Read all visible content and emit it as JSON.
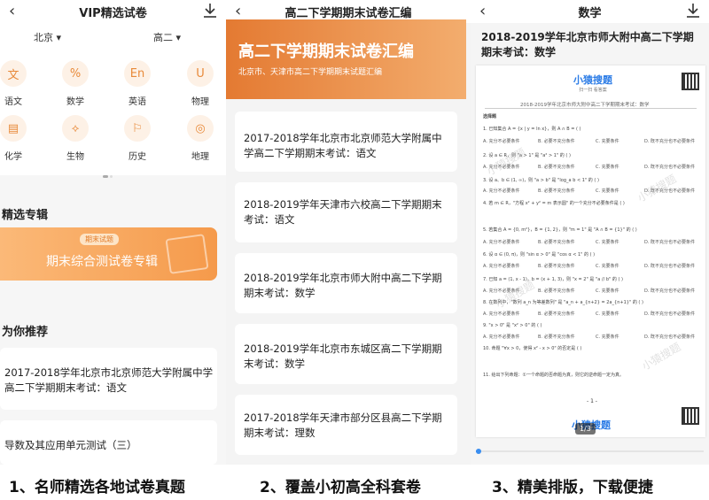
{
  "panel1": {
    "header_title": "VIP精选试卷",
    "filter_region": "北京 ▾",
    "filter_grade": "高二 ▾",
    "subjects": [
      {
        "label": "语文",
        "glyph": "文",
        "icon": "book-icon"
      },
      {
        "label": "数学",
        "glyph": "%",
        "icon": "percent-icon"
      },
      {
        "label": "英语",
        "glyph": "En",
        "icon": "english-icon"
      },
      {
        "label": "物理",
        "glyph": "U",
        "icon": "magnet-icon"
      },
      {
        "label": "化学",
        "glyph": "▤",
        "icon": "flask-icon"
      },
      {
        "label": "生物",
        "glyph": "⟡",
        "icon": "dna-icon"
      },
      {
        "label": "历史",
        "glyph": "⚐",
        "icon": "flag-icon"
      },
      {
        "label": "地理",
        "glyph": "◎",
        "icon": "globe-icon"
      }
    ],
    "featured_title": "精选专辑",
    "banner_tag": "期末试题",
    "banner_text": "期末综合测试卷专辑",
    "recommend_title": "为你推荐",
    "recommend_items": [
      "2017-2018学年北京市北京师范大学附属中学高二下学期期末考试：语文",
      "导数及其应用单元测试（三）"
    ]
  },
  "panel2": {
    "header_title": "高二下学期期末试卷汇编",
    "banner_title": "高二下学期期末试卷汇编",
    "banner_sub": "北京市、天津市高二下学期期末试题汇编",
    "items": [
      "2017-2018学年北京市北京师范大学附属中学高二下学期期末考试：语文",
      "2018-2019学年天津市六校高二下学期期末考试：语文",
      "2018-2019学年北京市师大附中高二下学期期末考试：数学",
      "2018-2019学年北京市东城区高二下学期期末考试：数学",
      "2017-2018学年天津市部分区县高二下学期期末考试：理数"
    ]
  },
  "panel3": {
    "header_title": "数学",
    "doc_title": "2018-2019学年北京市师大附中高二下学期期末考试：数学",
    "logo": "小猿搜题",
    "logo_sub": "扫一扫 看答案",
    "page_line": "2018-2019学年北京市师大附中高二下学期期末考试：数学",
    "section": "选择题",
    "questions": [
      "1. 已知集合 A = {x | y = ln x}，则 A ∩ B = (   )",
      "2. 设 a ∈ R，则 \"a > 1\" 是 \"a² > 1\" 的 (   )",
      "3. 设 a、b ∈ (1, ∞)，则 \"a > b\" 是 \"log_a b < 1\" 的 (   )",
      "4. 若 m ∈ R，\"方程 x² + y² = m 表示圆\" 的一个充分不必要条件是 (   )",
      "5. 若集合 A = {0, m²}，B = {1, 2}，则 \"m = 1\" 是 \"A ∩ B = {1}\" 的 (   )",
      "6. 设 α ∈ (0, π)，则 \"sin α > 0\" 是 \"cos α < 1\" 的 (   )",
      "7. 已知 a = (1, x - 1)，b = (x + 1, 3)，则 \"x = 2\" 是 \"a // b\" 的 (   )",
      "8. 在数列中，\"数列 a_n 为等差数列\" 是 \"a_n + a_{n+2} = 2a_{n+1}\" 的 (   )",
      "9. \"x > 0\" 是 \"x² > 0\" 的 (   )",
      "10. 命题 \"∀x > 0，使得 x² - x > 0\" 的否定是 (   )",
      "11. 给出下列命题：①一个命题的否命题为真，则它的逆命题一定为真。"
    ],
    "options": [
      "A. 充分不必要条件",
      "B. 必要不充分条件",
      "C. 充要条件",
      "D. 既不充分也不必要条件"
    ],
    "watermark": "小猿搜题",
    "page_number": "- 1 -",
    "page_counter": "1/3",
    "scroll_progress": 0.01
  },
  "captions": [
    "1、名师精选各地试卷真题",
    "2、覆盖小初高全科套卷",
    "3、精美排版，下载便捷"
  ],
  "colors": {
    "accent_orange": "#f59a4b",
    "progress_blue": "#3a8ef0",
    "logo_blue": "#2a7be6"
  }
}
